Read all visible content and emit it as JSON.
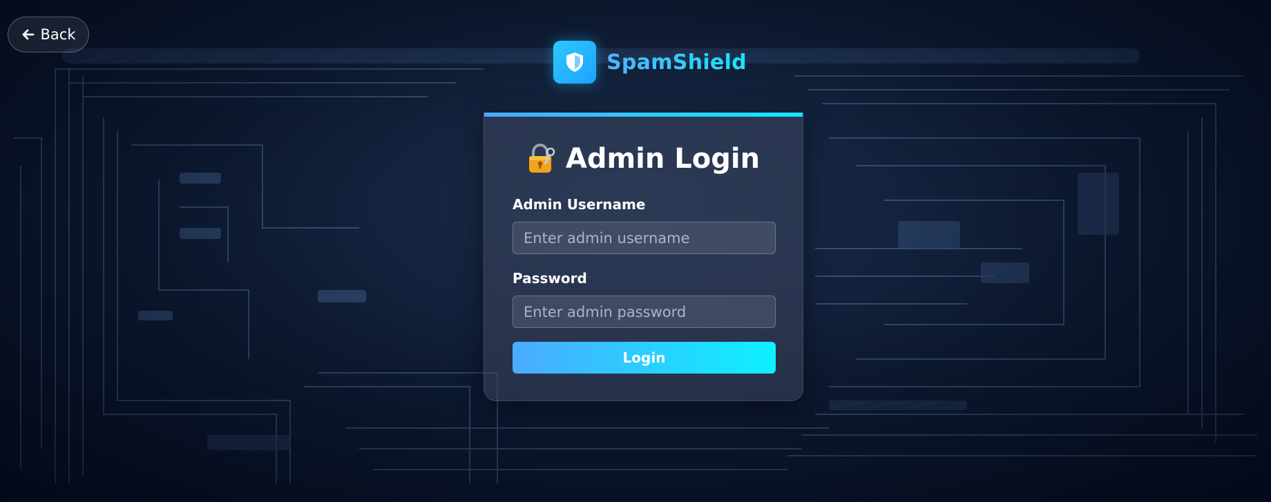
{
  "nav": {
    "back_label": "Back"
  },
  "brand": {
    "name": "SpamShield",
    "logo_icon": "shield-icon"
  },
  "login_card": {
    "title": "Admin Login",
    "title_icon": "lock-with-key-icon",
    "username": {
      "label": "Admin Username",
      "placeholder": "Enter admin username",
      "value": ""
    },
    "password": {
      "label": "Password",
      "placeholder": "Enter admin password",
      "value": ""
    },
    "submit_label": "Login"
  },
  "colors": {
    "accent_start": "#4aabff",
    "accent_end": "#0ef0ff",
    "background": "#0f1d36"
  }
}
